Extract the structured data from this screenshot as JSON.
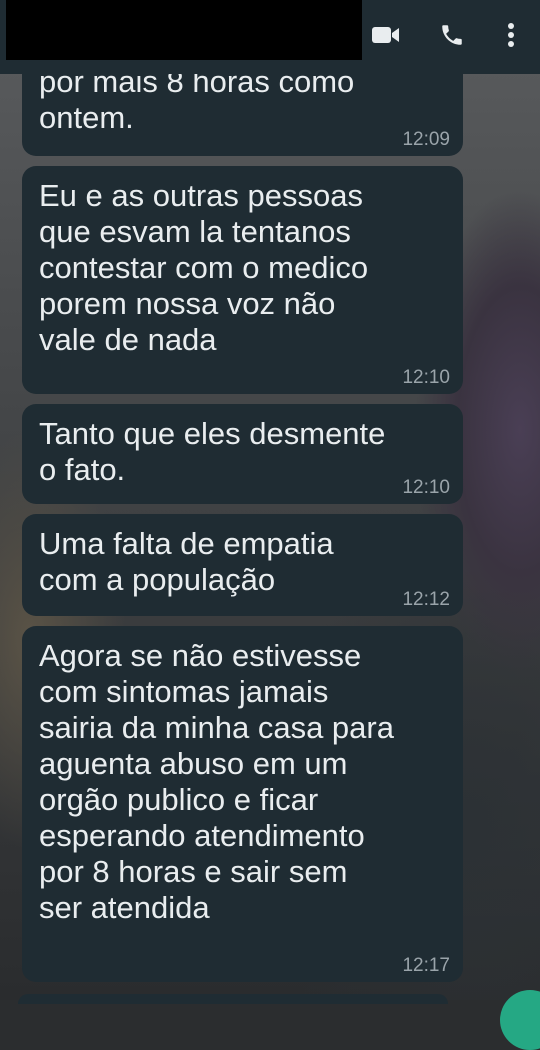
{
  "header": {
    "icons": [
      "video-call-icon",
      "voice-call-icon",
      "more-options-icon"
    ]
  },
  "messages": [
    {
      "text": "por mais 8 horas como\nontem.",
      "time": "12:09"
    },
    {
      "text": "Eu e as outras pessoas\nque esvam la tentanos\ncontestar com o medico\nporem nossa voz não\nvale de nada",
      "time": "12:10"
    },
    {
      "text": "Tanto que eles desmente\no fato.",
      "time": "12:10"
    },
    {
      "text": "Uma falta de empatia\ncom a população",
      "time": "12:12"
    },
    {
      "text": "Agora se não estivesse\ncom sintomas jamais\nsairia da minha casa para\naguenta abuso em um\norgão publico e ficar\nesperando atendimento\npor 8 horas e sair sem\nser atendida",
      "time": "12:17"
    }
  ],
  "colors": {
    "header_bg": "#1f2c33",
    "bubble_bg": "#1f2c33",
    "text": "#e9edef",
    "timestamp": "#9aa4aa",
    "accent": "#25a884"
  }
}
